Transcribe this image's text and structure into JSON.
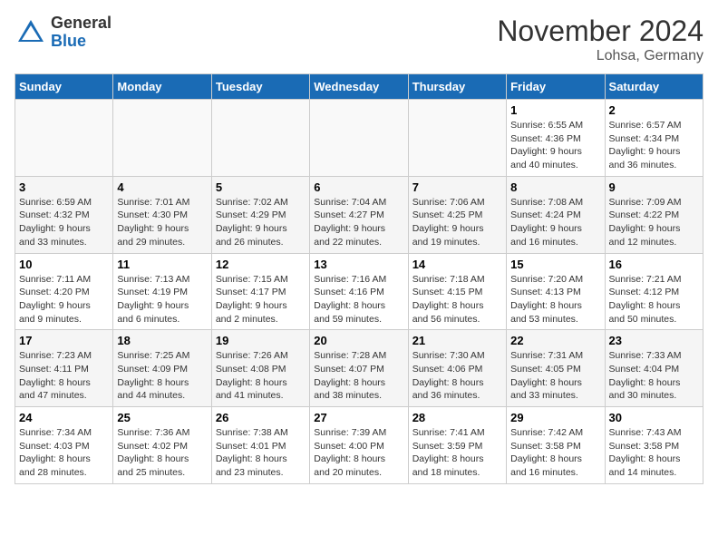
{
  "header": {
    "logo_general": "General",
    "logo_blue": "Blue",
    "month_title": "November 2024",
    "location": "Lohsa, Germany"
  },
  "days_of_week": [
    "Sunday",
    "Monday",
    "Tuesday",
    "Wednesday",
    "Thursday",
    "Friday",
    "Saturday"
  ],
  "weeks": [
    {
      "row_class": "row-white",
      "days": [
        {
          "date": "",
          "info": ""
        },
        {
          "date": "",
          "info": ""
        },
        {
          "date": "",
          "info": ""
        },
        {
          "date": "",
          "info": ""
        },
        {
          "date": "",
          "info": ""
        },
        {
          "date": "1",
          "info": "Sunrise: 6:55 AM\nSunset: 4:36 PM\nDaylight: 9 hours\nand 40 minutes."
        },
        {
          "date": "2",
          "info": "Sunrise: 6:57 AM\nSunset: 4:34 PM\nDaylight: 9 hours\nand 36 minutes."
        }
      ]
    },
    {
      "row_class": "row-gray",
      "days": [
        {
          "date": "3",
          "info": "Sunrise: 6:59 AM\nSunset: 4:32 PM\nDaylight: 9 hours\nand 33 minutes."
        },
        {
          "date": "4",
          "info": "Sunrise: 7:01 AM\nSunset: 4:30 PM\nDaylight: 9 hours\nand 29 minutes."
        },
        {
          "date": "5",
          "info": "Sunrise: 7:02 AM\nSunset: 4:29 PM\nDaylight: 9 hours\nand 26 minutes."
        },
        {
          "date": "6",
          "info": "Sunrise: 7:04 AM\nSunset: 4:27 PM\nDaylight: 9 hours\nand 22 minutes."
        },
        {
          "date": "7",
          "info": "Sunrise: 7:06 AM\nSunset: 4:25 PM\nDaylight: 9 hours\nand 19 minutes."
        },
        {
          "date": "8",
          "info": "Sunrise: 7:08 AM\nSunset: 4:24 PM\nDaylight: 9 hours\nand 16 minutes."
        },
        {
          "date": "9",
          "info": "Sunrise: 7:09 AM\nSunset: 4:22 PM\nDaylight: 9 hours\nand 12 minutes."
        }
      ]
    },
    {
      "row_class": "row-white",
      "days": [
        {
          "date": "10",
          "info": "Sunrise: 7:11 AM\nSunset: 4:20 PM\nDaylight: 9 hours\nand 9 minutes."
        },
        {
          "date": "11",
          "info": "Sunrise: 7:13 AM\nSunset: 4:19 PM\nDaylight: 9 hours\nand 6 minutes."
        },
        {
          "date": "12",
          "info": "Sunrise: 7:15 AM\nSunset: 4:17 PM\nDaylight: 9 hours\nand 2 minutes."
        },
        {
          "date": "13",
          "info": "Sunrise: 7:16 AM\nSunset: 4:16 PM\nDaylight: 8 hours\nand 59 minutes."
        },
        {
          "date": "14",
          "info": "Sunrise: 7:18 AM\nSunset: 4:15 PM\nDaylight: 8 hours\nand 56 minutes."
        },
        {
          "date": "15",
          "info": "Sunrise: 7:20 AM\nSunset: 4:13 PM\nDaylight: 8 hours\nand 53 minutes."
        },
        {
          "date": "16",
          "info": "Sunrise: 7:21 AM\nSunset: 4:12 PM\nDaylight: 8 hours\nand 50 minutes."
        }
      ]
    },
    {
      "row_class": "row-gray",
      "days": [
        {
          "date": "17",
          "info": "Sunrise: 7:23 AM\nSunset: 4:11 PM\nDaylight: 8 hours\nand 47 minutes."
        },
        {
          "date": "18",
          "info": "Sunrise: 7:25 AM\nSunset: 4:09 PM\nDaylight: 8 hours\nand 44 minutes."
        },
        {
          "date": "19",
          "info": "Sunrise: 7:26 AM\nSunset: 4:08 PM\nDaylight: 8 hours\nand 41 minutes."
        },
        {
          "date": "20",
          "info": "Sunrise: 7:28 AM\nSunset: 4:07 PM\nDaylight: 8 hours\nand 38 minutes."
        },
        {
          "date": "21",
          "info": "Sunrise: 7:30 AM\nSunset: 4:06 PM\nDaylight: 8 hours\nand 36 minutes."
        },
        {
          "date": "22",
          "info": "Sunrise: 7:31 AM\nSunset: 4:05 PM\nDaylight: 8 hours\nand 33 minutes."
        },
        {
          "date": "23",
          "info": "Sunrise: 7:33 AM\nSunset: 4:04 PM\nDaylight: 8 hours\nand 30 minutes."
        }
      ]
    },
    {
      "row_class": "row-white",
      "days": [
        {
          "date": "24",
          "info": "Sunrise: 7:34 AM\nSunset: 4:03 PM\nDaylight: 8 hours\nand 28 minutes."
        },
        {
          "date": "25",
          "info": "Sunrise: 7:36 AM\nSunset: 4:02 PM\nDaylight: 8 hours\nand 25 minutes."
        },
        {
          "date": "26",
          "info": "Sunrise: 7:38 AM\nSunset: 4:01 PM\nDaylight: 8 hours\nand 23 minutes."
        },
        {
          "date": "27",
          "info": "Sunrise: 7:39 AM\nSunset: 4:00 PM\nDaylight: 8 hours\nand 20 minutes."
        },
        {
          "date": "28",
          "info": "Sunrise: 7:41 AM\nSunset: 3:59 PM\nDaylight: 8 hours\nand 18 minutes."
        },
        {
          "date": "29",
          "info": "Sunrise: 7:42 AM\nSunset: 3:58 PM\nDaylight: 8 hours\nand 16 minutes."
        },
        {
          "date": "30",
          "info": "Sunrise: 7:43 AM\nSunset: 3:58 PM\nDaylight: 8 hours\nand 14 minutes."
        }
      ]
    }
  ]
}
